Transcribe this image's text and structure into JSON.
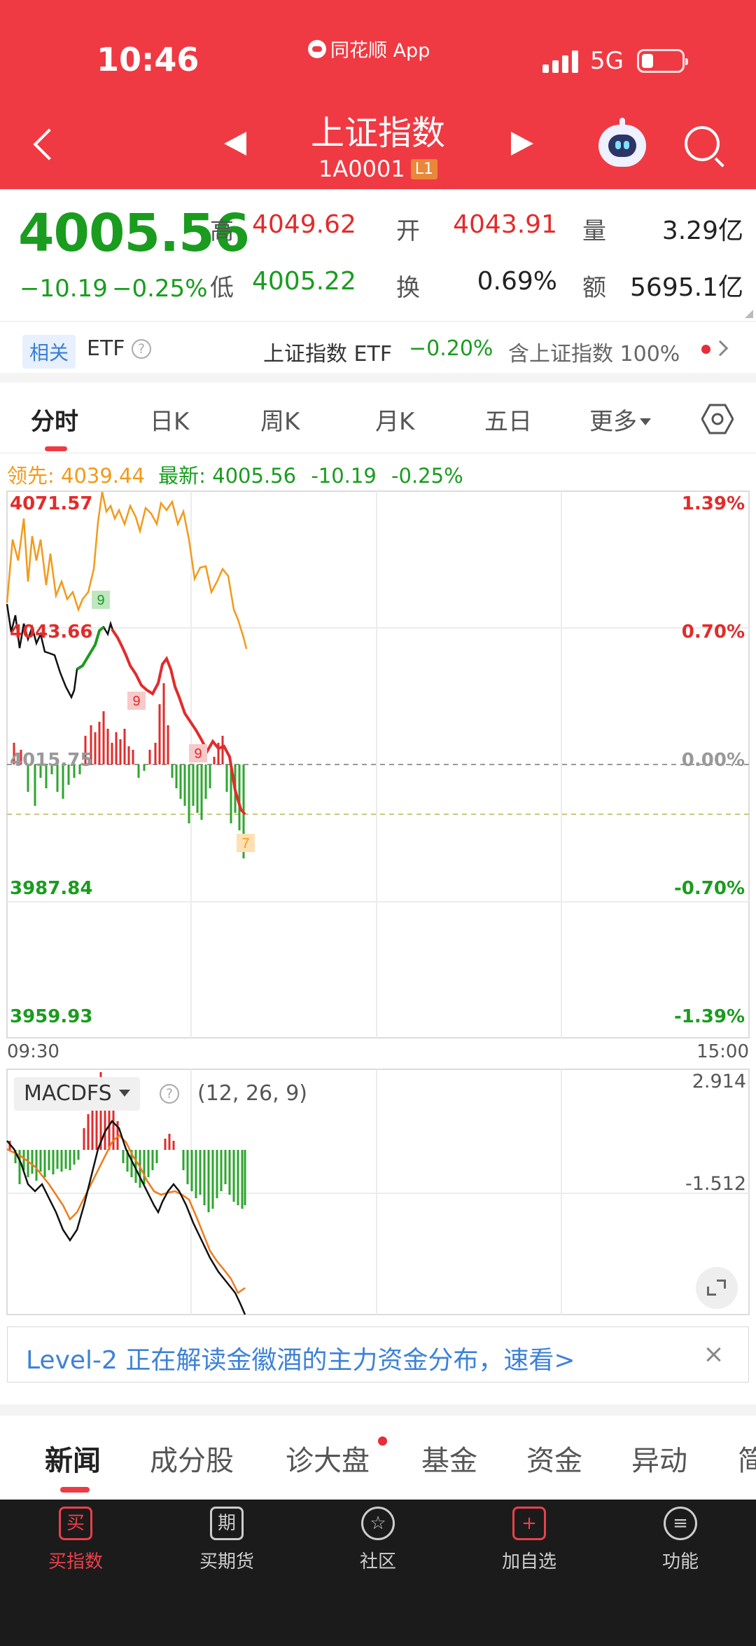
{
  "status": {
    "time": "10:46",
    "app": "同花顺 App",
    "network": "5G"
  },
  "header": {
    "title": "上证指数",
    "code": "1A0001",
    "level_badge": "L1"
  },
  "quote": {
    "price": "4005.56",
    "change": "−10.19",
    "change_pct": "−0.25%",
    "high_label": "高",
    "high": "4049.62",
    "low_label": "低",
    "low": "4005.22",
    "open_label": "开",
    "open": "4043.91",
    "turnover_label": "换",
    "turnover": "0.69%",
    "volume_label": "量",
    "volume": "3.29亿",
    "amount_label": "额",
    "amount": "5695.1亿"
  },
  "related": {
    "tag": "相关",
    "etf_label": "ETF",
    "etf_name": "上证指数 ETF",
    "etf_change": "−0.20%",
    "contains_label": "含上证指数",
    "contains_pct": "100%"
  },
  "period_tabs": [
    "分时",
    "日K",
    "周K",
    "月K",
    "五日",
    "更多"
  ],
  "info": {
    "lead_label": "领先:",
    "lead_value": "4039.44",
    "latest_label": "最新:",
    "latest_value": "4005.56",
    "latest_change": "-10.19",
    "latest_pct": "-0.25%"
  },
  "intraday": {
    "price_labels": {
      "top": "4071.57",
      "upper": "4043.66",
      "mid": "4015.75",
      "lower": "3987.84",
      "bottom": "3959.93"
    },
    "pct_labels": {
      "top": "1.39%",
      "upper": "0.70%",
      "mid": "0.00%",
      "lower": "-0.70%",
      "bottom": "-1.39%"
    },
    "time_start": "09:30",
    "time_end": "15:00",
    "markers": [
      "9",
      "9",
      "9",
      "7"
    ]
  },
  "macd": {
    "name": "MACDFS",
    "params": "(12, 26, 9)",
    "top_value": "2.914",
    "mid_value": "-1.512"
  },
  "banner": {
    "text": "Level-2 正在解读金徽酒的主力资金分布，速看>"
  },
  "news_tabs": [
    "新闻",
    "成分股",
    "诊大盘",
    "基金",
    "资金",
    "异动",
    "简"
  ],
  "bottom_nav": [
    {
      "label": "买指数",
      "icon": "买",
      "icon_name": "buy-index-icon"
    },
    {
      "label": "买期货",
      "icon": "期",
      "icon_name": "buy-futures-icon"
    },
    {
      "label": "社区",
      "icon": "☆",
      "icon_name": "community-icon"
    },
    {
      "label": "加自选",
      "icon": "+",
      "icon_name": "add-watchlist-icon"
    },
    {
      "label": "功能",
      "icon": "≡",
      "icon_name": "menu-icon"
    }
  ],
  "colors": {
    "brand_red": "#ef3a43",
    "up_red": "#e22b2b",
    "down_green": "#1a9c1f",
    "lead_orange": "#f29a1a",
    "link_blue": "#3d82d8"
  }
}
